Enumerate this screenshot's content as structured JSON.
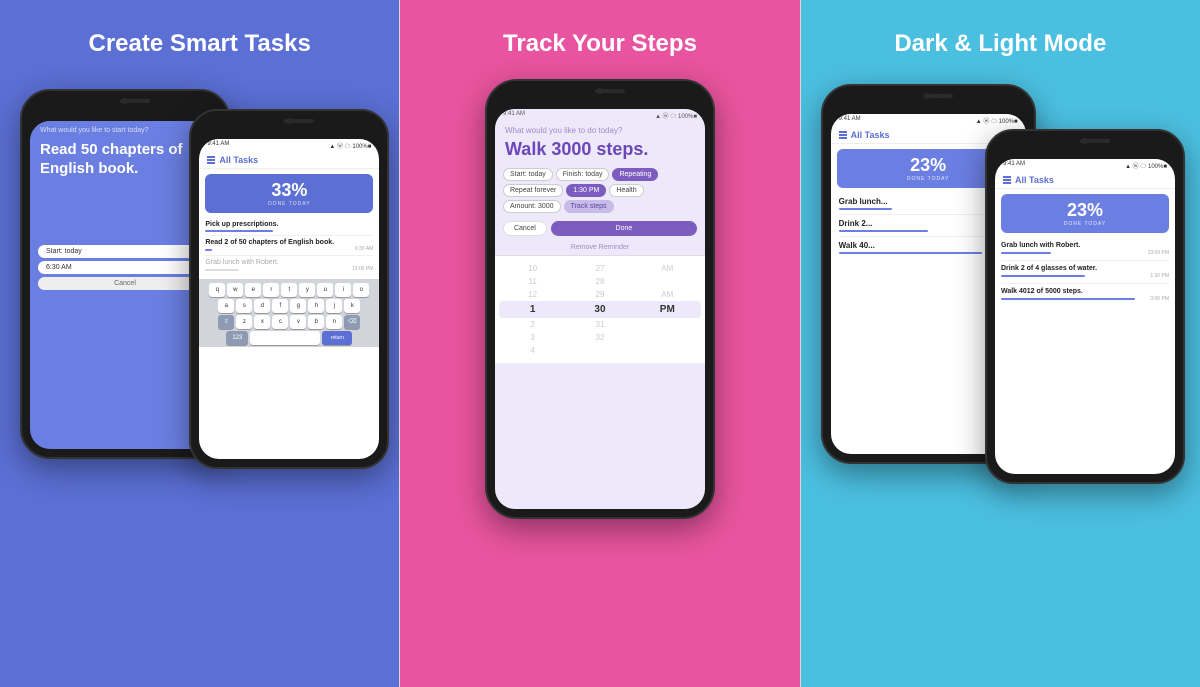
{
  "panels": [
    {
      "id": "panel1",
      "title": "Create Smart Tasks",
      "bg": "#5B6FD4",
      "back_phone": {
        "screen_bg": "#6B7FE3",
        "prompt": "What would you like to start today?",
        "main_text": "Read 50 chapters of English book.",
        "fields": [
          "Start: today",
          "6:30 AM",
          "Cancel"
        ]
      },
      "front_phone": {
        "header": "All Tasks",
        "progress_pct": "33%",
        "progress_label": "DONE TODAY",
        "tasks": [
          {
            "name": "Pick up prescriptions.",
            "bar_width": "40%",
            "time": ""
          },
          {
            "name": "Read 2 of 50 chapters of English book.",
            "bar_width": "4%",
            "time": "6:30 AM"
          },
          {
            "name": "Grab lunch with Robert.",
            "bar_width": "20%",
            "time": "12:00 PM"
          }
        ],
        "keyboard": {
          "rows": [
            [
              "q",
              "w",
              "e",
              "r",
              "t",
              "y",
              "u",
              "i",
              "o",
              "p"
            ],
            [
              "a",
              "s",
              "d",
              "f",
              "g",
              "h",
              "j",
              "k",
              "l"
            ],
            [
              "⇧",
              "z",
              "x",
              "c",
              "v",
              "b",
              "n",
              "m",
              "⌫"
            ],
            [
              "123",
              "space",
              "return"
            ]
          ]
        }
      }
    },
    {
      "id": "panel2",
      "title": "Track Your Steps",
      "bg": "#E8549F",
      "phone": {
        "prompt": "What would you like to do today?",
        "task": "Walk 3000 steps.",
        "tags": [
          {
            "label": "Start: today",
            "style": "outline"
          },
          {
            "label": "Finish: today",
            "style": "outline"
          },
          {
            "label": "Repeating",
            "style": "purple"
          },
          {
            "label": "Repeat forever",
            "style": "outline"
          },
          {
            "label": "1:30 PM",
            "style": "purple"
          },
          {
            "label": "Health",
            "style": "outline"
          },
          {
            "label": "Amount: 3000",
            "style": "outline"
          },
          {
            "label": "Track steps",
            "style": "lavender"
          }
        ],
        "cancel_label": "Cancel",
        "done_label": "Done",
        "remove_reminder": "Remove Reminder",
        "time_picker": {
          "cols": [
            "",
            "",
            ""
          ],
          "rows": [
            [
              "10",
              "27",
              "AM"
            ],
            [
              "11",
              "28",
              ""
            ],
            [
              "12",
              "29",
              "AM"
            ],
            [
              "1",
              "30",
              "PM"
            ],
            [
              "2",
              "31",
              ""
            ],
            [
              "3",
              "32",
              ""
            ],
            [
              "4",
              "",
              ""
            ]
          ],
          "selected_row": 3
        }
      }
    },
    {
      "id": "panel3",
      "title": "Dark & Light Mode",
      "bg": "#4BBFE0",
      "back_phone": {
        "header": "All Tasks",
        "progress_pct": "23%",
        "progress_label": "DONE TODAY",
        "tasks": [
          {
            "name": "Grab lunch...",
            "bar_width": "30%",
            "time": ""
          },
          {
            "name": "Drink 2...",
            "bar_width": "50%",
            "time": ""
          },
          {
            "name": "Walk 40...",
            "bar_width": "80%",
            "time": ""
          }
        ]
      },
      "front_phone": {
        "header": "All Tasks",
        "progress_pct": "23%",
        "progress_label": "DONE TODAY",
        "tasks": [
          {
            "name": "Grab lunch with Robert.",
            "sub": "",
            "bar_width": "30%",
            "time": "13:09 PM"
          },
          {
            "name": "Drink 2 of 4 glasses of water.",
            "sub": "",
            "bar_width": "50%",
            "time": "1:30 PM"
          },
          {
            "name": "Walk 4012 of 5000 steps.",
            "sub": "",
            "bar_width": "80%",
            "time": "3:06 PM"
          }
        ]
      }
    }
  ],
  "status_bar": {
    "time": "9:41 AM",
    "signal": "●●●",
    "wifi": "WiFi",
    "battery": "100%"
  }
}
